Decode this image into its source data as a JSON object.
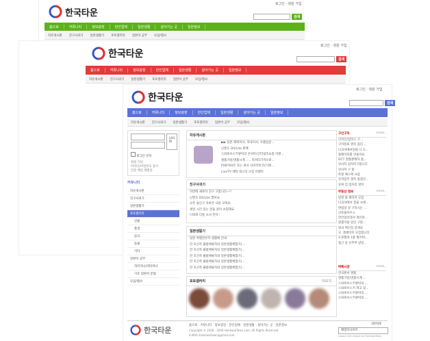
{
  "brand": {
    "name": "한국타운"
  },
  "top_links": "로그인 · 회원 가입",
  "search_button": "검색",
  "nav": [
    "홈으로",
    "커뮤니티",
    "정보광장",
    "한인업체",
    "일본생활",
    "살아가는 곳",
    "일본정보"
  ],
  "subnav": [
    "자유게시판",
    "친구사귀기",
    "일본생활기",
    "포토갤러리",
    "일본어 공부",
    "모임/행사"
  ],
  "login": {
    "button": "LOG IN",
    "keep_label": "로그인 유지",
    "links": [
      "회원 가입",
      "아이디/비밀번호 찾기",
      "인증 메일 재발송"
    ]
  },
  "side_menu": {
    "title": "커뮤니티",
    "items": [
      "자유게시판",
      "친구사귀기",
      "일본생활기",
      "포토갤러리",
      "인물",
      "풍경",
      "음식",
      "동물",
      "기타",
      "일본어 공부",
      "히라가나/카타카나",
      "기초 일본어 문법",
      "모임/행사"
    ],
    "active": 3
  },
  "free_board": {
    "title": "자유게시판",
    "items": [
      "▶▶ 일본 해외이사, 귀국이사, 수출입운...",
      "닌텐도 DS/Lite 판매",
      "스와로브스키큐빅의 콘서트(인터넷조쇼핑 이밴...",
      "명품가방/명품시계 ..... 럭셔리가격으로...",
      "PX8760은 또는 회사 사이러아크(?)에 ...",
      "LiveTV 베타 테스터 모집 이벤트"
    ]
  },
  "friends": {
    "title": "친구사귀기",
    "items": [
      "이번에 새로이 친구 구합니다~!!",
      "닌텐도 DS/Lite 팔아요",
      "오픈 솔인구 하루콘 사랑 모여요",
      "세일 시간 있는 분들 같이 쇼핑해요",
      "나와회 다름 소녀 전이 !"
    ]
  },
  "life": {
    "title": "일본생활기",
    "items": [
      "일본 여행관유학 생활에 안내",
      "한 조선족 불법체류자의 일본생활체험기(...",
      "한 조선족 불법체류자의 일본생활체험기(...",
      "한 조선족 불법체류자의 일본생활체험기(...",
      "한 조선족 불법체류자의 일본생활체험기(...",
      "한 조선족 불법체류자의 일본생활체험기(..."
    ]
  },
  "photo": {
    "title": "포토갤러리",
    "more": "더보기.."
  },
  "right": {
    "wanted": {
      "title": "구인구직",
      "more": "more..",
      "items": [
        "디자인/일러스 구...",
        "구미정로 명지 좀다 ...",
        "나고야에서일을 나 도...",
        "홈페이지를 만들어요",
        "DCT 명품판매자 홈...",
        "맛사지 일자리구합니다",
        "맛사지 구 합",
        "토할 예스에 사용",
        "유학업무 명지 합정인...",
        "유복 집 일자리 명지"
      ]
    },
    "realestate": {
      "title": "부동산 정보",
      "more": "more..",
      "items": [
        "방명 홈 페이지 모집",
        "나고야에서 집을 사세...",
        "연립일 방 구하시는 ...",
        "산토물하우스",
        "한인업인데서 개인원...",
        "원룸마을 방인 구합...",
        "외국 여인집 양세요",
        "오. 홈페이지 모집합니다",
        "도쿄월세 1롱  뭘어떠...",
        "접근 중 신주쿠 방일..."
      ]
    },
    "sale": {
      "title": "벼룩시장",
      "more": "more..",
      "items": [
        "한국판서 명품",
        "명품가방/명품시계 ...",
        "스와로브스키큐빅의 ...",
        "스와로브스키 파고 있...",
        "스와로브스키큐빅의 ...",
        "스와로브스키큐빅의 ..."
      ]
    }
  },
  "footer": {
    "links": "홈으로 · 커뮤니티 · 정보광장 · 한인업체 · 일본생활 · 살아가는 곳 · 일본정보",
    "copy": "Copyright © 2008 - 2009 HankookTown.com. All Rights Reserved.",
    "email": "E-MAIL:hankooktown@gmail.com",
    "site_select": "패밀리사이트",
    "credit": "Layout skin design by HankookTown"
  },
  "colors": {
    "green": "#5cb21a",
    "red": "#e43a3a",
    "blue": "#5a72d6"
  },
  "page_label": "1판차로"
}
